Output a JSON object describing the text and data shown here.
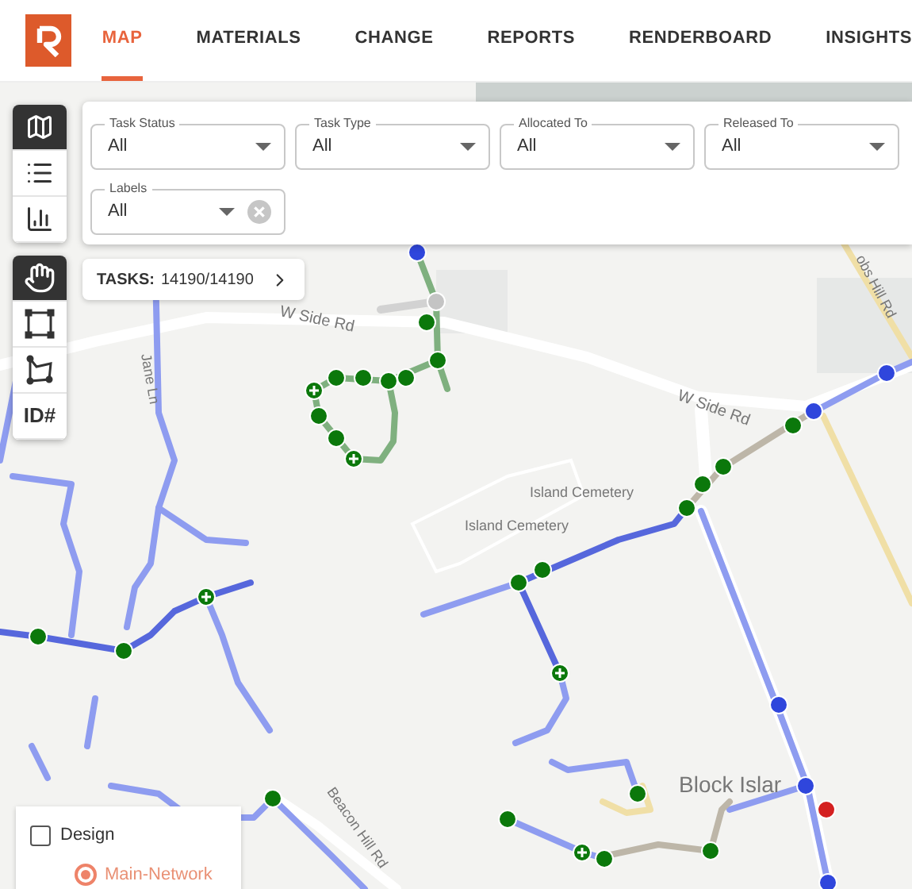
{
  "nav": {
    "tabs": [
      {
        "label": "MAP",
        "selected": true
      },
      {
        "label": "MATERIALS",
        "selected": false
      },
      {
        "label": "CHANGE",
        "selected": false
      },
      {
        "label": "REPORTS",
        "selected": false
      },
      {
        "label": "RENDERBOARD",
        "selected": false
      },
      {
        "label": "INSIGHTS",
        "selected": false
      }
    ]
  },
  "view_buttons": [
    {
      "kind": "map",
      "selected": true
    },
    {
      "kind": "list",
      "selected": false
    },
    {
      "kind": "chart",
      "selected": false
    }
  ],
  "tool_buttons": [
    {
      "kind": "hand",
      "selected": true
    },
    {
      "kind": "rectangle",
      "selected": false
    },
    {
      "kind": "polygon",
      "selected": false
    },
    {
      "kind": "id",
      "label": "ID#",
      "selected": false
    }
  ],
  "filters": [
    {
      "label": "Task Status",
      "value": "All",
      "clearable": false
    },
    {
      "label": "Task Type",
      "value": "All",
      "clearable": false
    },
    {
      "label": "Allocated To",
      "value": "All",
      "clearable": false
    },
    {
      "label": "Released To",
      "value": "All",
      "clearable": false
    },
    {
      "label": "Labels",
      "value": "All",
      "clearable": true
    }
  ],
  "tasks": {
    "label": "TASKS:",
    "count": "14190/14190"
  },
  "map_labels": [
    "W Side Rd",
    "W Side Rd",
    "Jane Ln",
    "obs Hill Rd",
    "Island Cemetery",
    "Island Cemetery",
    "Block Islar",
    "Beacon Hill Rd"
  ],
  "legend": {
    "items": [
      {
        "kind": "checkbox",
        "label": "Design",
        "checked": false
      },
      {
        "kind": "radio",
        "label": "Main-Network",
        "selected": true,
        "disabled": true
      }
    ]
  }
}
